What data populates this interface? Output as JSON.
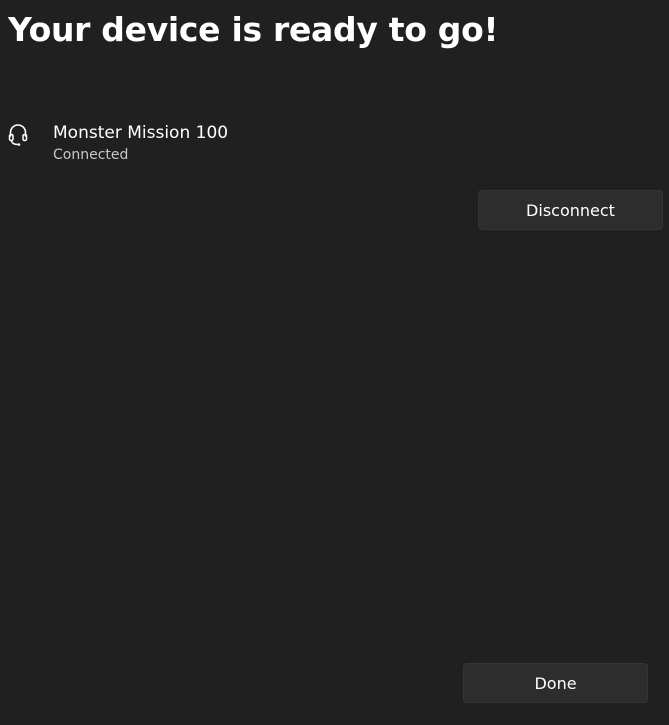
{
  "dialog": {
    "title": "Your device is ready to go!"
  },
  "device": {
    "icon": "headset-icon",
    "name": "Monster Mission 100",
    "status": "Connected"
  },
  "buttons": {
    "disconnect_label": "Disconnect",
    "done_label": "Done"
  },
  "colors": {
    "background": "#202020",
    "button_bg": "#2d2d2d",
    "text": "#ffffff",
    "secondary_text": "#c8c8c8"
  }
}
